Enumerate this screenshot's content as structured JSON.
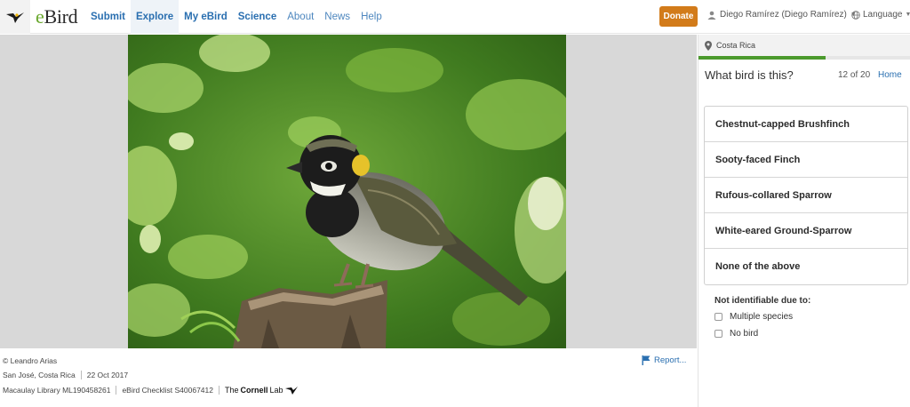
{
  "header": {
    "brand_prefix": "e",
    "brand_suffix": "Bird",
    "nav": [
      {
        "label": "Submit"
      },
      {
        "label": "Explore"
      },
      {
        "label": "My eBird"
      },
      {
        "label": "Science"
      },
      {
        "label": "About"
      },
      {
        "label": "News"
      },
      {
        "label": "Help"
      }
    ],
    "donate_label": "Donate",
    "user_label": "Diego Ramírez (Diego Ramírez)",
    "language_label": "Language"
  },
  "credits": {
    "photographer": "© Leandro Arias",
    "location": "San José, Costa Rica",
    "date": "22 Oct 2017",
    "macaulay": "Macaulay Library ML190458261",
    "checklist": "eBird Checklist S40067412",
    "cornell_the": "The",
    "cornell_name": "Cornell",
    "cornell_lab": "Lab",
    "report_label": "Report..."
  },
  "quiz": {
    "location": "Costa Rica",
    "progress": 0.6,
    "title": "What bird is this?",
    "count": "12 of 20",
    "home_label": "Home",
    "answers": [
      {
        "label": "Chestnut-capped Brushfinch"
      },
      {
        "label": "Sooty-faced Finch"
      },
      {
        "label": "Rufous-collared Sparrow"
      },
      {
        "label": "White-eared Ground-Sparrow"
      },
      {
        "label": "None of the above"
      }
    ],
    "not_identifiable_title": "Not identifiable due to:",
    "options": [
      {
        "label": "Multiple species"
      },
      {
        "label": "No bird"
      }
    ]
  },
  "colors": {
    "brand_green": "#6aa82e",
    "link_blue": "#2a6fb0",
    "donate_orange": "#d27b1a",
    "progress_green": "#4b9a2d"
  }
}
